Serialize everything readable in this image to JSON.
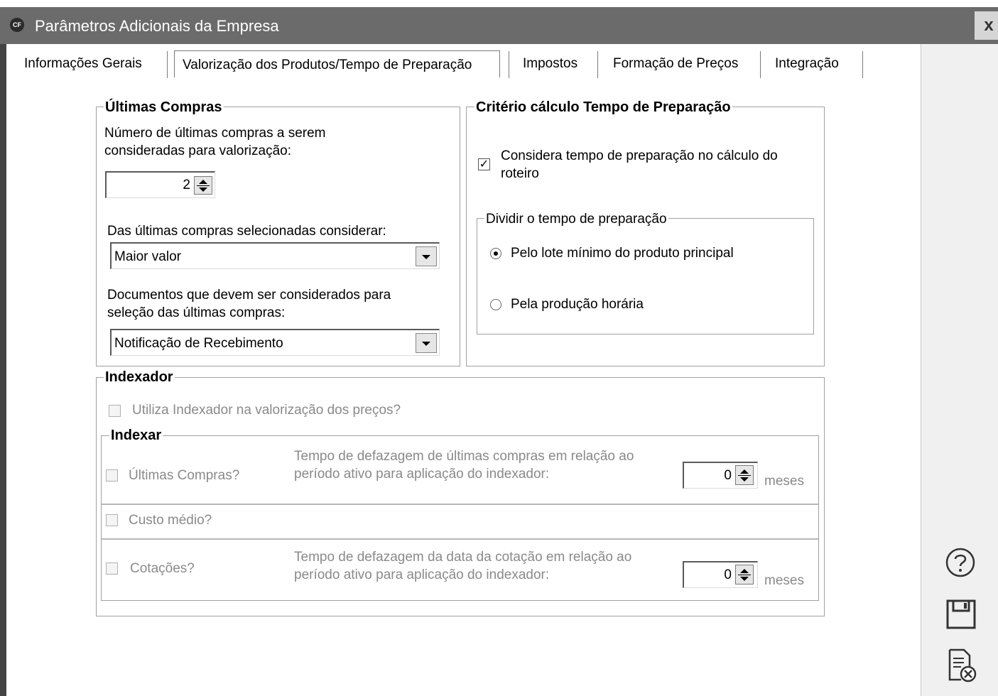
{
  "window": {
    "title": "Parâmetros Adicionais da Empresa",
    "app_icon_text": "CF",
    "close_label": "x"
  },
  "tabs": [
    {
      "label": "Informações Gerais",
      "active": false
    },
    {
      "label": "Valorização dos Produtos/Tempo de Preparação",
      "active": true
    },
    {
      "label": "Impostos",
      "active": false
    },
    {
      "label": "Formação de Preços",
      "active": false
    },
    {
      "label": "Integração",
      "active": false
    }
  ],
  "ultimas_compras": {
    "legend": "Últimas Compras",
    "numero_label_1": "Número de últimas compras a serem",
    "numero_label_2": "consideradas para valorização:",
    "numero_value": "2",
    "considerar_label": "Das últimas compras selecionadas considerar:",
    "considerar_value": "Maior valor",
    "documentos_label_1": "Documentos que devem ser considerados para",
    "documentos_label_2": "seleção das últimas compras:",
    "documentos_value": "Notificação de Recebimento"
  },
  "criterio": {
    "legend": "Critério cálculo Tempo de Preparação",
    "considera_label_1": "Considera tempo de preparação no cálculo do",
    "considera_label_2": "roteiro",
    "considera_checked": true,
    "dividir_legend": "Dividir o tempo de preparação",
    "option_lote": "Pelo lote mínimo do produto principal",
    "option_producao": "Pela produção horária",
    "selected_option": "Pelo lote mínimo do produto principal"
  },
  "indexador": {
    "legend": "Indexador",
    "utiliza_label": "Utiliza Indexador na valorização dos preços?",
    "indexar_legend": "Indexar",
    "ultimas_compras_label": "Últimas Compras?",
    "defazagem_compras_1": "Tempo de defazagem de últimas compras em relação ao",
    "defazagem_compras_2": "período ativo para aplicação do indexador:",
    "defazagem_compras_value": "0",
    "meses_1": "meses",
    "custo_medio_label": "Custo médio?",
    "cotacoes_label": "Cotações?",
    "defazagem_cotacao_1": "Tempo de defazagem da data da cotação em relação ao",
    "defazagem_cotacao_2": "período ativo para aplicação do indexador:",
    "defazagem_cotacao_value": "0",
    "meses_2": "meses"
  },
  "sidebar": {
    "help_icon": "help-icon",
    "save_icon": "save-icon",
    "cancel_icon": "cancel-document-icon"
  }
}
